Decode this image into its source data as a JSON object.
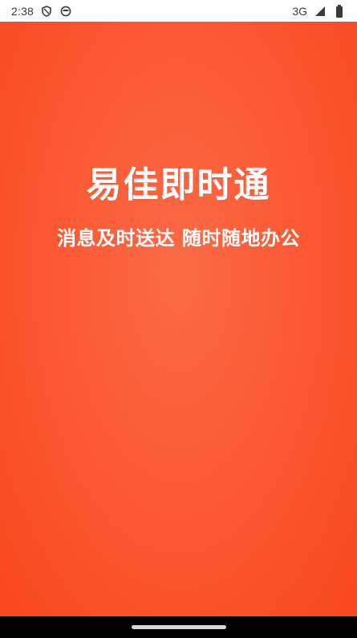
{
  "status_bar": {
    "time": "2:38",
    "network": "3G",
    "icons": [
      "shield-icon",
      "face-icon",
      "signal-icon",
      "battery-icon"
    ]
  },
  "splash": {
    "title": "易佳即时通",
    "slogan": "消息及时送达 随时随地办公",
    "background_color": "#fb5a35",
    "text_color": "#ffffff"
  }
}
